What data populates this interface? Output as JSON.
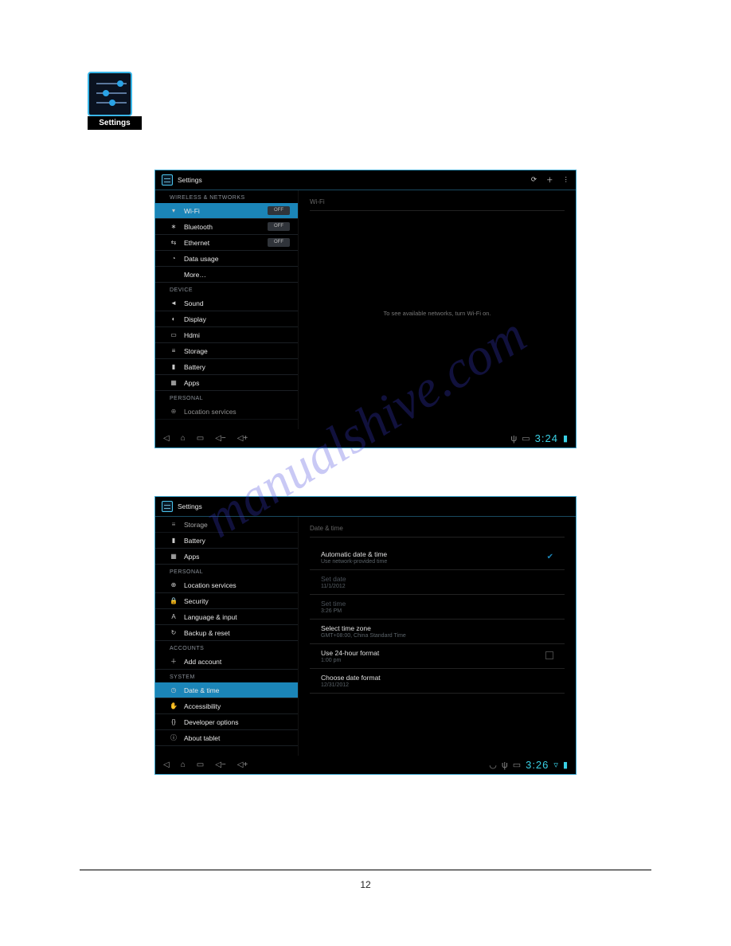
{
  "page_number": "12",
  "watermark": "manualshive.com",
  "app_icon": {
    "label": "Settings"
  },
  "screenshot1": {
    "title": "Settings",
    "actions": {
      "refresh": "⟳",
      "add": "＋",
      "menu": "⋮"
    },
    "sidebar": {
      "cat_wireless": "WIRELESS & NETWORKS",
      "wifi": "Wi-Fi",
      "bluetooth": "Bluetooth",
      "ethernet": "Ethernet",
      "data_usage": "Data usage",
      "more": "More…",
      "cat_device": "DEVICE",
      "sound": "Sound",
      "display": "Display",
      "hdmi": "Hdmi",
      "storage": "Storage",
      "battery": "Battery",
      "apps": "Apps",
      "cat_personal": "PERSONAL",
      "location": "Location services",
      "toggle_off": "OFF"
    },
    "content": {
      "title": "Wi-Fi",
      "msg": "To see available networks, turn Wi-Fi on."
    },
    "sysbar": {
      "clock": "3:24"
    }
  },
  "screenshot2": {
    "title": "Settings",
    "sidebar": {
      "storage": "Storage",
      "battery": "Battery",
      "apps": "Apps",
      "cat_personal": "PERSONAL",
      "location": "Location services",
      "security": "Security",
      "language": "Language & input",
      "backup": "Backup & reset",
      "cat_accounts": "ACCOUNTS",
      "add_account": "Add account",
      "cat_system": "SYSTEM",
      "datetime": "Date & time",
      "accessibility": "Accessibility",
      "developer": "Developer options",
      "about": "About tablet"
    },
    "content": {
      "title": "Date & time",
      "auto": {
        "label": "Automatic date & time",
        "sub": "Use network-provided time"
      },
      "set_date": {
        "label": "Set date",
        "sub": "11/1/2012"
      },
      "set_time": {
        "label": "Set time",
        "sub": "3:26 PM"
      },
      "tz": {
        "label": "Select time zone",
        "sub": "GMT+08:00, China Standard Time"
      },
      "h24": {
        "label": "Use 24-hour format",
        "sub": "1:00 pm"
      },
      "fmt": {
        "label": "Choose date format",
        "sub": "12/31/2012"
      }
    },
    "sysbar": {
      "clock": "3:26"
    }
  },
  "nav_icons": {
    "back": "◁",
    "home": "⌂",
    "recents": "▭",
    "vol_dn": "◁−",
    "vol_up": "◁+"
  }
}
